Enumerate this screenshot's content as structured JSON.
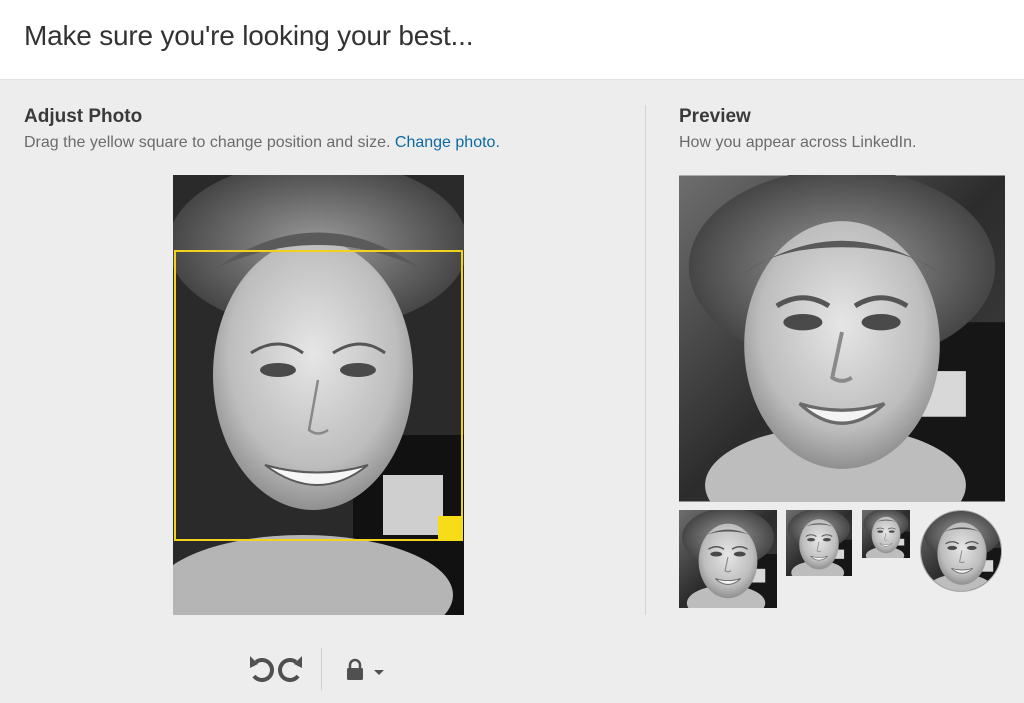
{
  "header": {
    "title": "Make sure you're looking your best..."
  },
  "adjust": {
    "title": "Adjust Photo",
    "instruction": "Drag the yellow square to change position and size.",
    "change_photo": "Change photo."
  },
  "preview": {
    "title": "Preview",
    "subtitle": "How you appear across LinkedIn."
  },
  "toolbar": {
    "rotate_left_icon": "rotate-left-icon",
    "rotate_right_icon": "rotate-right-icon",
    "lock_icon": "lock-icon",
    "dropdown_icon": "caret-down-icon"
  },
  "colors": {
    "crop_border": "#f2d21b",
    "crop_handle": "#f7dc19",
    "link": "#0b6aa2"
  }
}
